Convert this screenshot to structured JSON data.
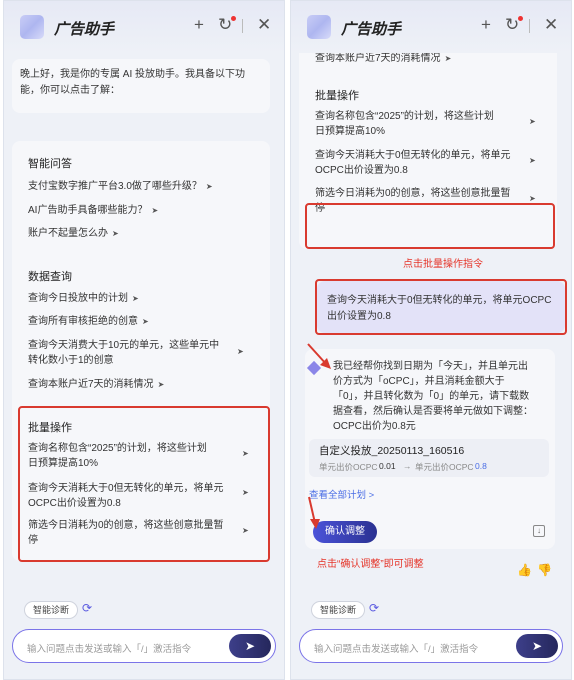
{
  "header": {
    "title": "广告助手"
  },
  "left": {
    "greeting": [
      "晚上好，我是你的专属 AI 投放助手。我具备以下功",
      "能，你可以点击了解："
    ],
    "sections": [
      {
        "heading": "智能问答",
        "items": [
          "支付宝数字推广平台3.0做了哪些升级？",
          "AI广告助手具备哪些能力？",
          "账户不起量怎么办"
        ]
      },
      {
        "heading": "数据查询",
        "items": [
          "查询今日投放中的计划",
          "查询所有审核拒绝的创意",
          "查询今天消费大于10元的单元，这些单元中",
          "转化数小于1的创意",
          "查询本账户近7天的消耗情况"
        ]
      },
      {
        "heading": "批量操作",
        "items": [
          "查询名称包含“2025”的计划，将这些计划",
          "日预算提高10%",
          "查询今天消耗大于0但无转化的单元，将单元",
          "OCPC出价设置为0.8",
          "筛选今日消耗为0的创意，将这些创意批量暂",
          "停"
        ]
      }
    ],
    "chip": "智能诊断",
    "input_placeholder": "输入问题点击发送或输入「/」激活指令"
  },
  "right": {
    "top_item_cut": "转化数小于1的创意",
    "top_item": "查询本账户近7天的消耗情况",
    "batch_heading": "批量操作",
    "batch_items": [
      "查询名称包含“2025”的计划，将这些计划",
      "日预算提高10%",
      "查询今天消耗大于0但无转化的单元，将单元",
      "OCPC出价设置为0.8",
      "筛选今日消耗为0的创意，将这些创意批量暂",
      "停"
    ],
    "annotation_batch": "点击批量操作指令",
    "user_msg": [
      "查询今天消耗大于0但无转化的单元，将单元OCPC",
      "出价设置为0.8"
    ],
    "bot_msg": [
      "我已经帮你找到日期为「今天」，并且单元出",
      "价方式为「oCPC」，并且消耗金额大于",
      "「0」，并且转化数为「0」的单元，请下载数",
      "据查看，然后确认是否要将单元做如下调整：",
      "OCPC出价为0.8元"
    ],
    "plan_name": "自定义投放_20250113_160516",
    "bid_label": "单元出价OCPC",
    "bid_old": "0.01",
    "bid_new_label": "单元出价OCPC",
    "bid_new": "0.8",
    "view_all": "查看全部计划 >",
    "confirm_btn": "确认调整",
    "annotation_confirm": "点击“确认调整”即可调整",
    "chip": "智能诊断",
    "input_placeholder": "输入问题点击发送或输入「/」激活指令"
  },
  "colors": {
    "accent": "#4b53d9",
    "annotation": "#e5352a"
  }
}
